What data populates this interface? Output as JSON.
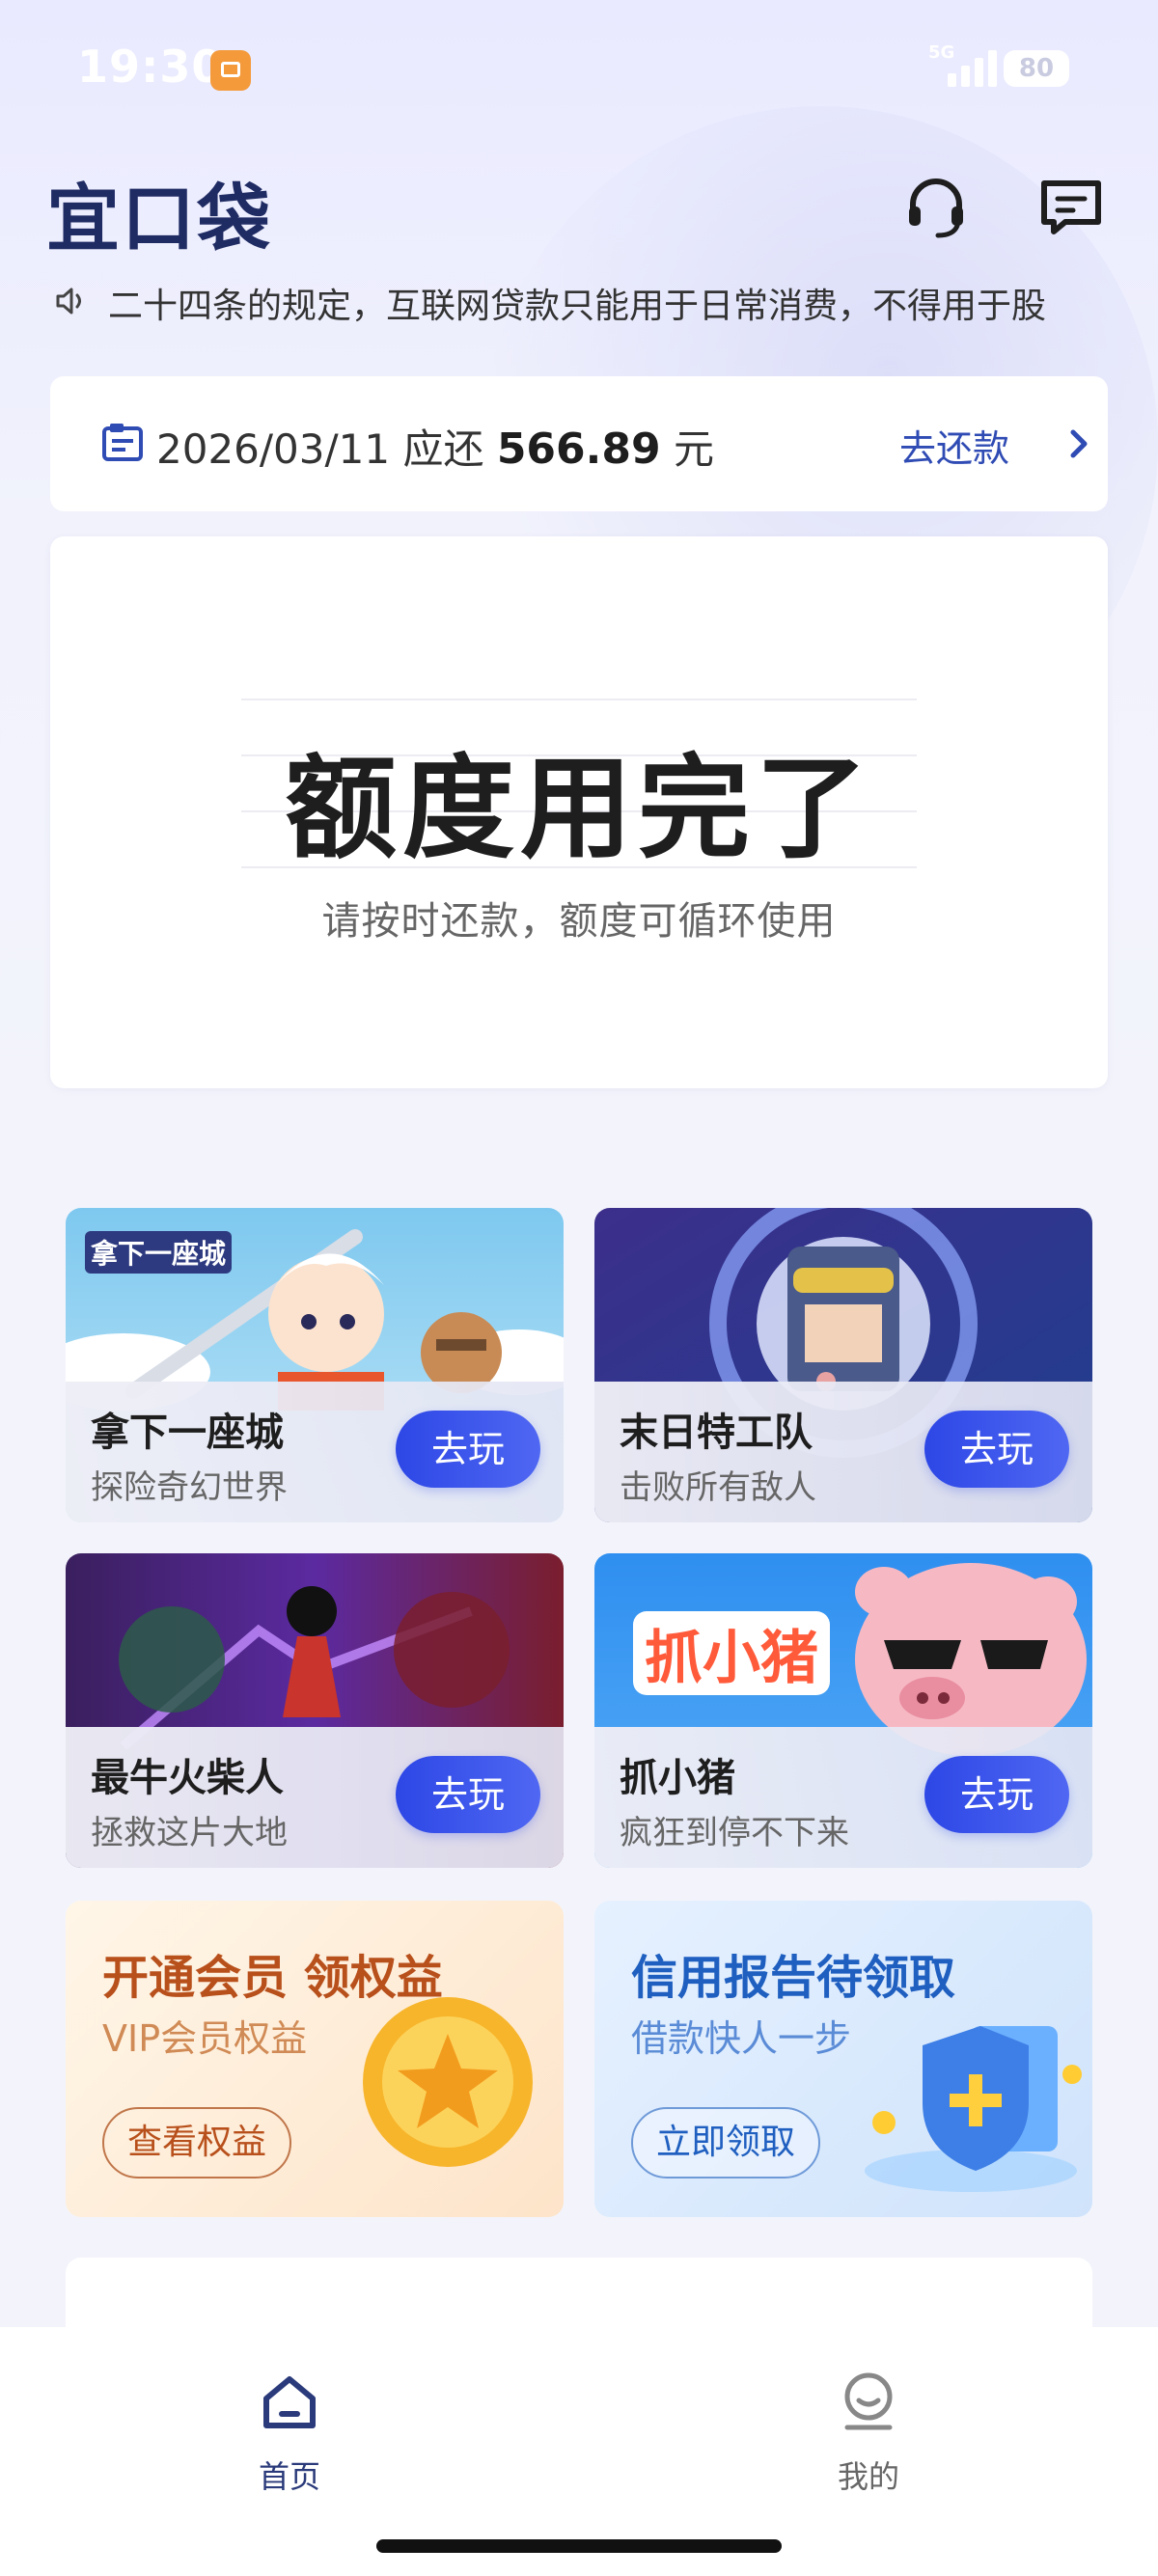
{
  "status_bar": {
    "time": "19:30",
    "network": "5G",
    "battery": "80"
  },
  "header": {
    "logo": "宜口袋",
    "support_icon": "headset-icon",
    "message_icon": "message-icon"
  },
  "notice": {
    "icon": "speaker-icon",
    "text": "二十四条的规定，互联网贷款只能用于日常消费，不得用于股"
  },
  "repay": {
    "date": "2026/03/11",
    "due_label": "应还",
    "amount": "566.89",
    "unit": "元",
    "action": "去还款"
  },
  "quota": {
    "title": "额度用完了",
    "subtitle": "请按时还款，额度可循环使用"
  },
  "games": [
    {
      "art_label": "拿下一座城",
      "title": "拿下一座城",
      "subtitle": "探险奇幻世界",
      "button": "去玩"
    },
    {
      "title": "末日特工队",
      "subtitle": "击败所有敌人",
      "button": "去玩"
    },
    {
      "title": "最牛火柴人",
      "subtitle": "拯救这片大地",
      "button": "去玩"
    },
    {
      "art_label": "抓小猪",
      "title": "抓小猪",
      "subtitle": "疯狂到停不下来",
      "button": "去玩"
    }
  ],
  "promos": [
    {
      "title": "开通会员 领权益",
      "subtitle": "VIP会员权益",
      "button": "查看权益"
    },
    {
      "title": "信用报告待领取",
      "subtitle": "借款快人一步",
      "button": "立即领取"
    }
  ],
  "bottom_nav": [
    {
      "label": "首页",
      "icon": "home-icon",
      "active": true
    },
    {
      "label": "我的",
      "icon": "profile-icon",
      "active": false
    }
  ],
  "colors": {
    "accent": "#2d47e6",
    "brand": "#1f2b63",
    "link": "#2f4bb4",
    "promo_orange": "#b8501c",
    "promo_blue": "#1f5fc0"
  }
}
